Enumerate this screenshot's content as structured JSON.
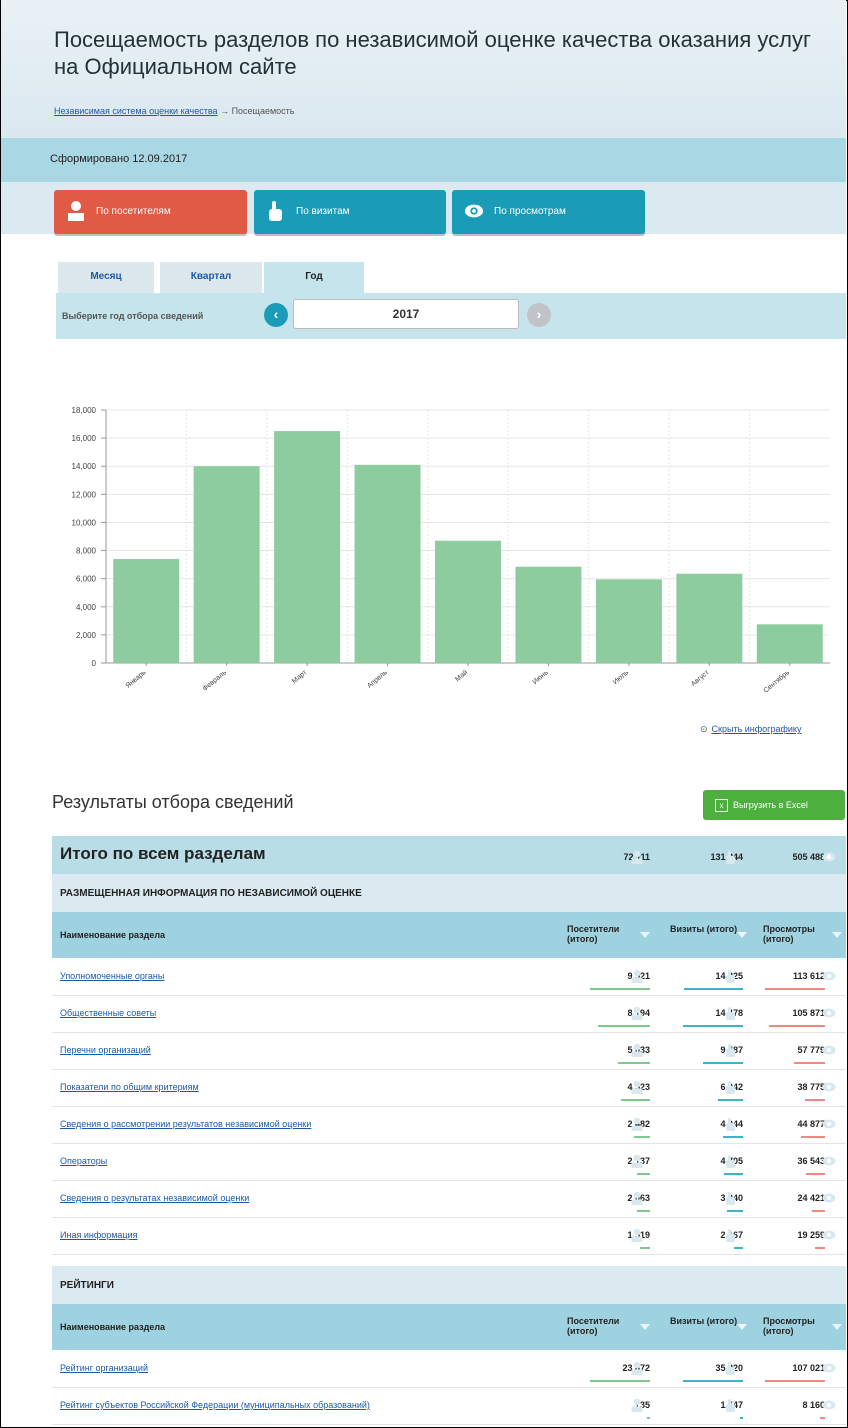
{
  "header": {
    "title": "Посещаемость разделов по независимой оценке качества оказания услуг на Официальном сайте",
    "breadcrumb_link": "Независимая система оценки качества",
    "breadcrumb_current": "→ Посещаемость"
  },
  "formed": "Сформировано 12.09.2017",
  "modes": {
    "visitors": "По посетителям",
    "visits": "По визитам",
    "views": "По просмотрам"
  },
  "period_tabs": [
    "Месяц",
    "Квартал",
    "Год"
  ],
  "year_selector": {
    "label": "Выберите год отбора сведений",
    "value": "2017",
    "prev_icon": "chevron-left-icon",
    "next_icon": "chevron-right-icon"
  },
  "chart_data": {
    "type": "bar",
    "categories": [
      "Январь",
      "Февраль",
      "Март",
      "Апрель",
      "Май",
      "Июнь",
      "Июль",
      "Август",
      "Сентябрь"
    ],
    "values": [
      7400,
      14000,
      16500,
      14100,
      8700,
      6850,
      5950,
      6350,
      2750
    ],
    "ylim": [
      0,
      18000
    ],
    "yticks": [
      "0",
      "2,000",
      "4,000",
      "6,000",
      "8,000",
      "10,000",
      "12,000",
      "14,000",
      "16,000",
      "18,000"
    ],
    "bar_color": "#8ccc9e",
    "grid": true
  },
  "hide_infographic": "Скрыть инфографику",
  "results": {
    "title": "Результаты отбора сведений",
    "excel_button": "Выгрузить в Excel",
    "total_label": "Итого по всем разделам",
    "total_visitors": "72 111",
    "total_visits": "131 844",
    "total_views": "505 488"
  },
  "columns": {
    "name": "Наименование раздела",
    "visitors": "Посетители (итого)",
    "visits": "Визиты (итого)",
    "views": "Просмотры (итого)"
  },
  "colors": {
    "visitors": "#7ec98e",
    "visits": "#3bb5cc",
    "views": "#f08a80",
    "accent_red": "#e05a45",
    "accent_teal": "#1a9cb8"
  },
  "section1": {
    "title": "РАЗМЕЩЕННАЯ ИНФОРМАЦИЯ ПО НЕЗАВИСИМОЙ ОЦЕНКЕ",
    "rows": [
      {
        "name": "Уполномоченные органы",
        "visitors": "9 521",
        "visits": "14 325",
        "views": "113 612"
      },
      {
        "name": "Общественные советы",
        "visitors": "8 194",
        "visits": "14 478",
        "views": "105 871"
      },
      {
        "name": "Перечни организаций",
        "visitors": "5 033",
        "visits": "9 587",
        "views": "57 779"
      },
      {
        "name": "Показатели по общим критериям",
        "visitors": "4 523",
        "visits": "6 042",
        "views": "38 775"
      },
      {
        "name": "Сведения о рассмотрении результатов независимой оценки",
        "visitors": "2 482",
        "visits": "4 944",
        "views": "44 877"
      },
      {
        "name": "Операторы",
        "visitors": "2 137",
        "visits": "4 705",
        "views": "36 543"
      },
      {
        "name": "Сведения о результатах независимой оценки",
        "visitors": "2 063",
        "visits": "3 940",
        "views": "24 421"
      },
      {
        "name": "Иная информация",
        "visitors": "1 519",
        "visits": "2 167",
        "views": "19 259"
      }
    ]
  },
  "section2": {
    "title": "РЕЙТИНГИ",
    "rows": [
      {
        "name": "Рейтинг организаций",
        "visitors": "23 672",
        "visits": "35 220",
        "views": "107 021"
      },
      {
        "name": "Рейтинг субъектов Российской Федерации (муниципальных образований)",
        "visitors": "735",
        "visits": "1 547",
        "views": "8 160"
      }
    ]
  }
}
